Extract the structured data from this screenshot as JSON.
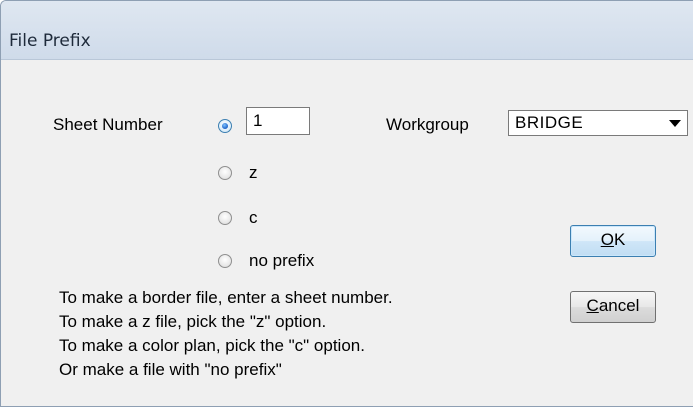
{
  "window": {
    "title": "File Prefix"
  },
  "sheet_number": {
    "label": "Sheet Number",
    "value": "1"
  },
  "prefix_options": [
    {
      "label": "",
      "checked": true
    },
    {
      "label": "z",
      "checked": false
    },
    {
      "label": "c",
      "checked": false
    },
    {
      "label": "no prefix",
      "checked": false
    }
  ],
  "workgroup": {
    "label": "Workgroup",
    "selected": "BRIDGE"
  },
  "buttons": {
    "ok_accel": "O",
    "ok_rest": "K",
    "cancel_accel": "C",
    "cancel_rest": "ancel"
  },
  "instructions": [
    "To make a border file, enter a sheet number.",
    "To make a z file, pick the \"z\" option.",
    "To make a color plan, pick the \"c\" option.",
    "Or make a file with \"no prefix\""
  ]
}
